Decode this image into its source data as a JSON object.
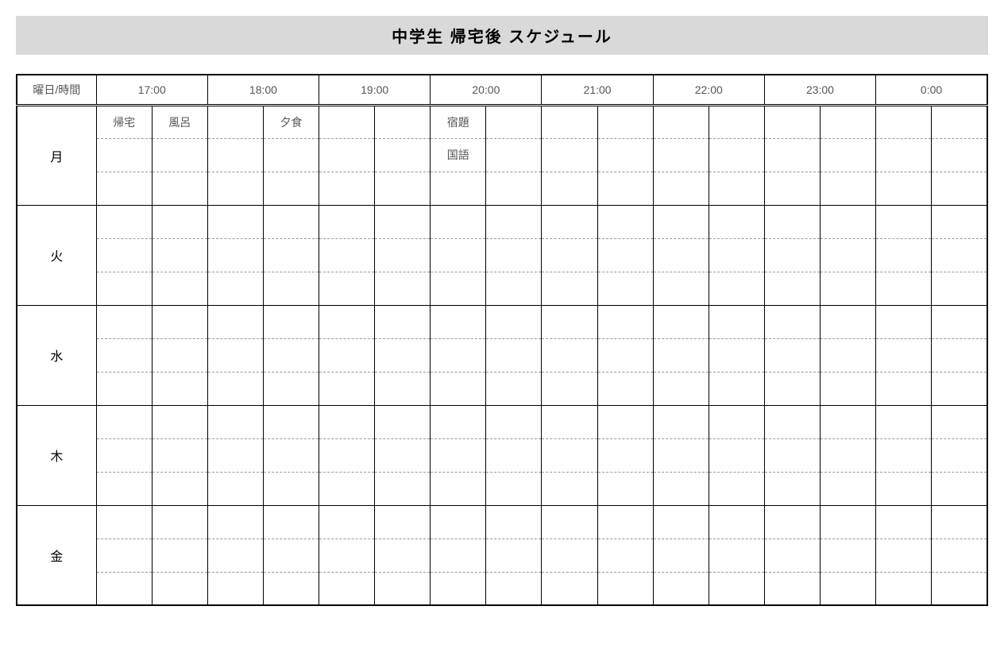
{
  "title": "中学生 帰宅後 スケジュール",
  "corner_label": "曜日/時間",
  "hours": [
    "17:00",
    "18:00",
    "19:00",
    "20:00",
    "21:00",
    "22:00",
    "23:00",
    "0:00"
  ],
  "days": [
    "月",
    "火",
    "水",
    "木",
    "金"
  ],
  "entries": {
    "mon": {
      "row1": [
        "帰宅",
        "風呂",
        "",
        "夕食",
        "",
        "",
        "宿題",
        "",
        "",
        "",
        "",
        "",
        "",
        "",
        "",
        ""
      ],
      "row2": [
        "",
        "",
        "",
        "",
        "",
        "",
        "国語",
        "",
        "",
        "",
        "",
        "",
        "",
        "",
        "",
        ""
      ],
      "row3": [
        "",
        "",
        "",
        "",
        "",
        "",
        "",
        "",
        "",
        "",
        "",
        "",
        "",
        "",
        "",
        ""
      ]
    },
    "tue": {
      "row1": [
        "",
        "",
        "",
        "",
        "",
        "",
        "",
        "",
        "",
        "",
        "",
        "",
        "",
        "",
        "",
        ""
      ],
      "row2": [
        "",
        "",
        "",
        "",
        "",
        "",
        "",
        "",
        "",
        "",
        "",
        "",
        "",
        "",
        "",
        ""
      ],
      "row3": [
        "",
        "",
        "",
        "",
        "",
        "",
        "",
        "",
        "",
        "",
        "",
        "",
        "",
        "",
        "",
        ""
      ]
    },
    "wed": {
      "row1": [
        "",
        "",
        "",
        "",
        "",
        "",
        "",
        "",
        "",
        "",
        "",
        "",
        "",
        "",
        "",
        ""
      ],
      "row2": [
        "",
        "",
        "",
        "",
        "",
        "",
        "",
        "",
        "",
        "",
        "",
        "",
        "",
        "",
        "",
        ""
      ],
      "row3": [
        "",
        "",
        "",
        "",
        "",
        "",
        "",
        "",
        "",
        "",
        "",
        "",
        "",
        "",
        "",
        ""
      ]
    },
    "thu": {
      "row1": [
        "",
        "",
        "",
        "",
        "",
        "",
        "",
        "",
        "",
        "",
        "",
        "",
        "",
        "",
        "",
        ""
      ],
      "row2": [
        "",
        "",
        "",
        "",
        "",
        "",
        "",
        "",
        "",
        "",
        "",
        "",
        "",
        "",
        "",
        ""
      ],
      "row3": [
        "",
        "",
        "",
        "",
        "",
        "",
        "",
        "",
        "",
        "",
        "",
        "",
        "",
        "",
        "",
        ""
      ]
    },
    "fri": {
      "row1": [
        "",
        "",
        "",
        "",
        "",
        "",
        "",
        "",
        "",
        "",
        "",
        "",
        "",
        "",
        "",
        ""
      ],
      "row2": [
        "",
        "",
        "",
        "",
        "",
        "",
        "",
        "",
        "",
        "",
        "",
        "",
        "",
        "",
        "",
        ""
      ],
      "row3": [
        "",
        "",
        "",
        "",
        "",
        "",
        "",
        "",
        "",
        "",
        "",
        "",
        "",
        "",
        "",
        ""
      ]
    }
  }
}
